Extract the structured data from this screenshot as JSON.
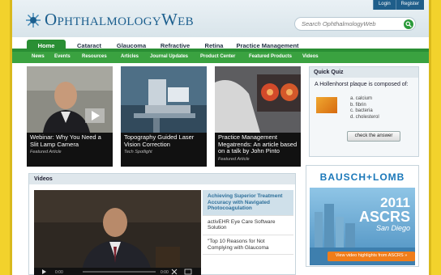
{
  "site": {
    "logo": "OphthalmologyWeb"
  },
  "topbar": {
    "login": "Login",
    "register": "Register"
  },
  "search": {
    "placeholder": "Search OphthalmologyWeb"
  },
  "nav": {
    "primary": [
      "Home",
      "Cataract",
      "Glaucoma",
      "Refractive",
      "Retina",
      "Practice Management"
    ],
    "active": "Home",
    "secondary": [
      "News",
      "Events",
      "Resources",
      "Articles",
      "Journal Updates",
      "Product Center",
      "Featured Products",
      "Videos"
    ]
  },
  "features": [
    {
      "title": "Webinar: Why You Need a Slit Lamp Camera",
      "tag": "Featured Article"
    },
    {
      "title": "Topography Guided Laser Vision Correction",
      "tag": "Tech Spotlight"
    },
    {
      "title": "Practice Management Megatrends: An article based on a talk by John Pinto",
      "tag": "Featured Article"
    }
  ],
  "quiz": {
    "header": "Quick Quiz",
    "question": "A Hollenhorst plaque is composed of:",
    "answers": [
      "a. calcium",
      "b. fibrin",
      "c. bacteria",
      "d. cholesterol"
    ],
    "button": "check the answer"
  },
  "videos": {
    "header": "Videos",
    "items": [
      "Achieving Superior Treatment Accuracy with Navigated Photocoagulation",
      "activEHR Eye Care Software Solution",
      "\"Top 10 Reasons for Not Complying with Glaucoma"
    ],
    "time": "0:00"
  },
  "ad": {
    "brand": "BAUSCH+LOMB",
    "year": "2011",
    "event": "ASCRS",
    "city": "San Diego",
    "cta": "View video highlights from ASCRS »"
  },
  "colors": {
    "accent_green": "#2a8f34",
    "brand_blue": "#1c5f8e",
    "background_yellow": "#f2d22c"
  }
}
